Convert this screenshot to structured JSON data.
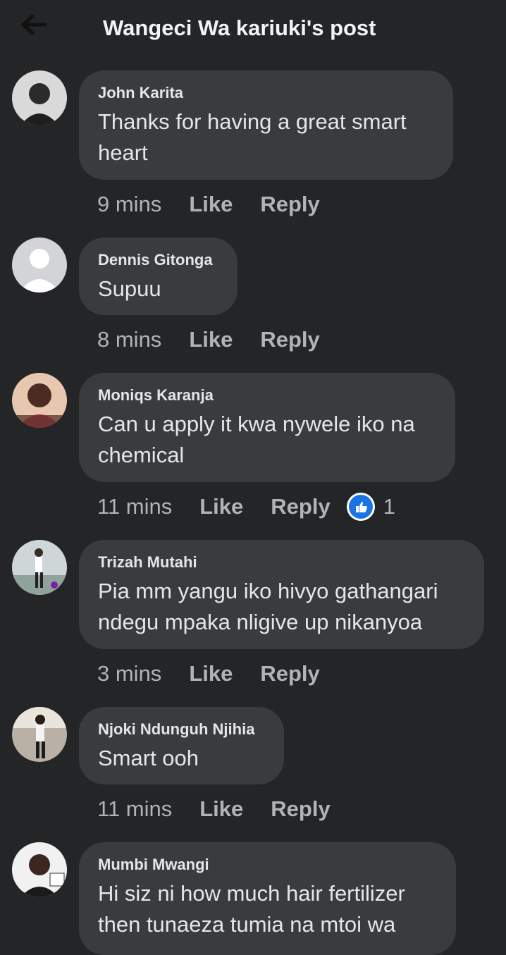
{
  "header": {
    "title": "Wangeci Wa kariuki's post",
    "back_icon": "arrow-left-icon"
  },
  "actions": {
    "like": "Like",
    "reply": "Reply"
  },
  "comments": [
    {
      "author": "John Karita",
      "text": "Thanks for having a great smart heart",
      "time": "9 mins"
    },
    {
      "author": "Dennis Gitonga",
      "text": "Supuu",
      "time": "8 mins"
    },
    {
      "author": "Moniqs Karanja",
      "text": "Can u apply it kwa nywele iko na chemical",
      "time": "11 mins",
      "reaction": {
        "icon": "like-icon",
        "count": "1",
        "color": "#1b74e4"
      }
    },
    {
      "author": "Trizah Mutahi",
      "text": "Pia mm yangu iko hivyo gathangari ndegu mpaka nligive up nikanyoa",
      "time": "3 mins"
    },
    {
      "author": "Njoki Ndunguh Njihia",
      "text": "Smart ooh",
      "time": "11 mins"
    },
    {
      "author": "Mumbi Mwangi",
      "text": "Hi siz ni how much hair fertilizer then tunaeza tumia na mtoi wa",
      "time": ""
    }
  ],
  "colors": {
    "background": "#242526",
    "bubble": "#3a3b3c",
    "text": "#e4e6eb",
    "meta": "#b0b3b8",
    "like_blue": "#1b74e4"
  }
}
